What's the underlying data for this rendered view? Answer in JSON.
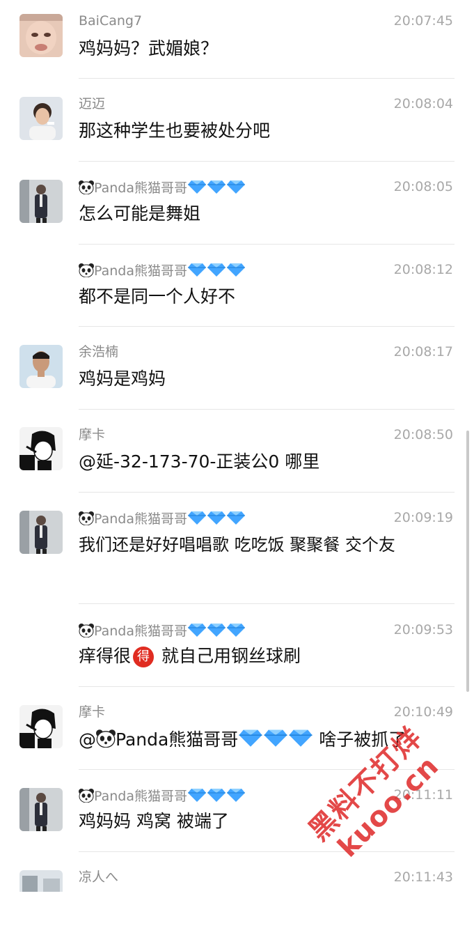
{
  "messages": [
    {
      "name": "BaiCang7",
      "time": "20:07:45",
      "text": "鸡妈妈？武媚娘？"
    },
    {
      "name": "迈迈",
      "time": "20:08:04",
      "text": "那这种学生也要被处分吧"
    },
    {
      "name": "Panda熊猫哥哥",
      "time": "20:08:05",
      "text": "怎么可能是舞姐"
    },
    {
      "name": "Panda熊猫哥哥",
      "time": "20:08:12",
      "text": "都不是同一个人好不"
    },
    {
      "name": "余浩楠",
      "time": "20:08:17",
      "text": "鸡妈是鸡妈"
    },
    {
      "name": "摩卡",
      "time": "20:08:50",
      "text": "@延-32-173-70-正装公0 哪里"
    },
    {
      "name": "Panda熊猫哥哥",
      "time": "20:09:19",
      "text": "我们还是好好唱唱歌 吃吃饭 聚聚餐 交个友"
    },
    {
      "name": "Panda熊猫哥哥",
      "time": "20:09:53",
      "text_a": "痒得很",
      "badge": "得",
      "text_b": " 就自己用钢丝球刷"
    },
    {
      "name": "摩卡",
      "time": "20:10:49",
      "mention_prefix": "@",
      "mention_name": "Panda熊猫哥哥",
      "text_after": " 啥子被抓了"
    },
    {
      "name": "Panda熊猫哥哥",
      "time": "20:11:11",
      "text": "鸡妈妈 鸡窝 被端了"
    },
    {
      "name": "凉人へ",
      "time": "20:11:43",
      "text": ""
    }
  ],
  "watermark": {
    "line1": "黑料不打烊",
    "line2": "kuoo.cn"
  },
  "colors": {
    "background": "#ffffff",
    "name": "#8a8a8a",
    "time": "#a8a8a8",
    "text": "#111111",
    "divider": "#e6e6e6",
    "gem": "#3aa0ff",
    "badge": "#e02c21",
    "watermark": "#de2828"
  }
}
